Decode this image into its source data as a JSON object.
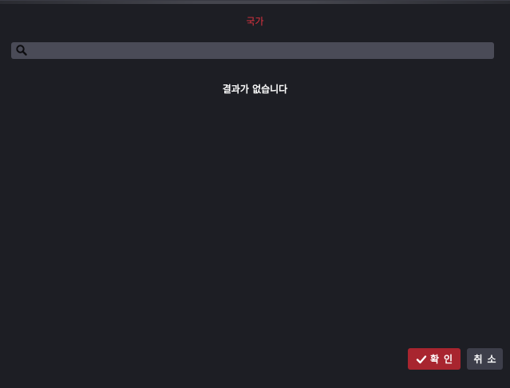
{
  "dialog": {
    "title": "국가",
    "search": {
      "placeholder": "",
      "value": "",
      "icon": "search-icon"
    },
    "empty_message": "결과가 없습니다",
    "buttons": {
      "confirm_label": "확인",
      "confirm_icon": "check-icon",
      "cancel_label": "취소"
    }
  },
  "colors": {
    "background": "#1d1e24",
    "accent": "#e0323f",
    "confirm_button": "#a8252f",
    "cancel_button": "#3d3e4a",
    "search_field": "#4a4b57"
  }
}
